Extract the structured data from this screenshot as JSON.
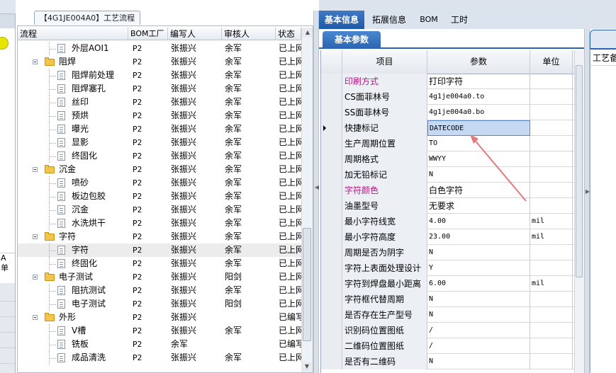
{
  "tree": {
    "title_tab": "【4G1JE004A0】工艺流程",
    "headers": [
      "流程",
      "BOM工厂",
      "编写人",
      "审核人",
      "状态"
    ],
    "rows": [
      {
        "level": 2,
        "name": "外层AOI1",
        "bom": "P2",
        "writer": "张振兴",
        "reviewer": "余军",
        "status": "已上网"
      },
      {
        "level": 1,
        "name": "阻焊",
        "bom": "P2",
        "writer": "张振兴",
        "reviewer": "余军",
        "status": "已上网"
      },
      {
        "level": 2,
        "name": "阻焊前处理",
        "bom": "P2",
        "writer": "张振兴",
        "reviewer": "余军",
        "status": "已上网"
      },
      {
        "level": 2,
        "name": "阻焊塞孔",
        "bom": "P2",
        "writer": "张振兴",
        "reviewer": "余军",
        "status": "已上网"
      },
      {
        "level": 2,
        "name": "丝印",
        "bom": "P2",
        "writer": "张振兴",
        "reviewer": "余军",
        "status": "已上网"
      },
      {
        "level": 2,
        "name": "预烘",
        "bom": "P2",
        "writer": "张振兴",
        "reviewer": "余军",
        "status": "已上网"
      },
      {
        "level": 2,
        "name": "曝光",
        "bom": "P2",
        "writer": "张振兴",
        "reviewer": "余军",
        "status": "已上网"
      },
      {
        "level": 2,
        "name": "显影",
        "bom": "P2",
        "writer": "张振兴",
        "reviewer": "余军",
        "status": "已上网"
      },
      {
        "level": 2,
        "name": "终固化",
        "bom": "P2",
        "writer": "张振兴",
        "reviewer": "余军",
        "status": "已上网"
      },
      {
        "level": 1,
        "name": "沉金",
        "bom": "P2",
        "writer": "张振兴",
        "reviewer": "余军",
        "status": "已上网"
      },
      {
        "level": 2,
        "name": "喷砂",
        "bom": "P2",
        "writer": "张振兴",
        "reviewer": "余军",
        "status": "已上网"
      },
      {
        "level": 2,
        "name": "板边包胶",
        "bom": "P2",
        "writer": "张振兴",
        "reviewer": "余军",
        "status": "已上网"
      },
      {
        "level": 2,
        "name": "沉金",
        "bom": "P2",
        "writer": "张振兴",
        "reviewer": "余军",
        "status": "已上网"
      },
      {
        "level": 2,
        "name": "水洗烘干",
        "bom": "P2",
        "writer": "张振兴",
        "reviewer": "余军",
        "status": "已上网"
      },
      {
        "level": 1,
        "name": "字符",
        "bom": "P2",
        "writer": "张振兴",
        "reviewer": "余军",
        "status": "已上网"
      },
      {
        "level": 2,
        "name": "字符",
        "bom": "P2",
        "writer": "张振兴",
        "reviewer": "余军",
        "status": "已上网",
        "selected": true
      },
      {
        "level": 2,
        "name": "终固化",
        "bom": "P2",
        "writer": "张振兴",
        "reviewer": "余军",
        "status": "已上网"
      },
      {
        "level": 1,
        "name": "电子测试",
        "bom": "P2",
        "writer": "张振兴",
        "reviewer": "阳剑",
        "status": "已上网"
      },
      {
        "level": 2,
        "name": "阻抗测试",
        "bom": "P2",
        "writer": "张振兴",
        "reviewer": "余军",
        "status": "已上网"
      },
      {
        "level": 2,
        "name": "电子测试",
        "bom": "P2",
        "writer": "张振兴",
        "reviewer": "阳剑",
        "status": "已上网"
      },
      {
        "level": 1,
        "name": "外形",
        "bom": "P2",
        "writer": "张振兴",
        "reviewer": "",
        "status": "已编写"
      },
      {
        "level": 2,
        "name": "V槽",
        "bom": "P2",
        "writer": "张振兴",
        "reviewer": "余军",
        "status": "已上网"
      },
      {
        "level": 2,
        "name": "铣板",
        "bom": "P2",
        "writer": "余军",
        "reviewer": "",
        "status": "已编写"
      },
      {
        "level": 2,
        "name": "成品清洗",
        "bom": "P2",
        "writer": "张振兴",
        "reviewer": "余军",
        "status": "已上网"
      }
    ]
  },
  "right": {
    "tabs": [
      "基本信息",
      "拓展信息",
      "BOM",
      "工时"
    ],
    "active_tab": 0,
    "subtab": "基本参数",
    "grid_headers": [
      "项目",
      "参数",
      "单位"
    ],
    "rows": [
      {
        "item": "印刷方式",
        "param": "打印字符",
        "unit": "",
        "item_color": "#b5177f"
      },
      {
        "item": "CS面菲林号",
        "param": "4g1je004a0.to",
        "unit": "",
        "mono": true
      },
      {
        "item": "SS面菲林号",
        "param": "4g1je004a0.bo",
        "unit": "",
        "mono": true
      },
      {
        "item": "快捷标记",
        "param": "DATECODE",
        "unit": "",
        "mono": true,
        "current": true
      },
      {
        "item": "生产周期位置",
        "param": "TO",
        "unit": "",
        "mono": true
      },
      {
        "item": "周期格式",
        "param": "WWYY",
        "unit": "",
        "mono": true
      },
      {
        "item": "加无铅标记",
        "param": "N",
        "unit": "",
        "mono": true
      },
      {
        "item": "字符颜色",
        "param": "白色字符",
        "unit": "",
        "item_color": "#b5177f"
      },
      {
        "item": "油墨型号",
        "param": "无要求",
        "unit": ""
      },
      {
        "item": "最小字符线宽",
        "param": "4.00",
        "unit": "mil",
        "mono": true
      },
      {
        "item": "最小字符高度",
        "param": "23.00",
        "unit": "mil",
        "mono": true
      },
      {
        "item": "周期是否为阴字",
        "param": "N",
        "unit": "",
        "mono": true
      },
      {
        "item": "字符上表面处理设计",
        "param": "Y",
        "unit": "",
        "mono": true
      },
      {
        "item": "字符到焊盘最小距离",
        "param": "6.00",
        "unit": "mil",
        "mono": true
      },
      {
        "item": "字符框代替周期",
        "param": "N",
        "unit": "",
        "mono": true
      },
      {
        "item": "是否存在生产型号",
        "param": "N",
        "unit": "",
        "mono": true
      },
      {
        "item": "识别码位置图纸",
        "param": "/",
        "unit": "",
        "mono": true
      },
      {
        "item": "二维码位置图纸",
        "param": "/",
        "unit": "",
        "mono": true
      },
      {
        "item": "是否有二维码",
        "param": "N",
        "unit": "",
        "mono": true
      }
    ],
    "far_right_label": "工艺备注"
  },
  "left_strip": {
    "label": "A\n单"
  },
  "colors": {
    "accent": "#2b63b0",
    "arrow": "#e07a7a",
    "highlight": "#c5d9f2"
  }
}
